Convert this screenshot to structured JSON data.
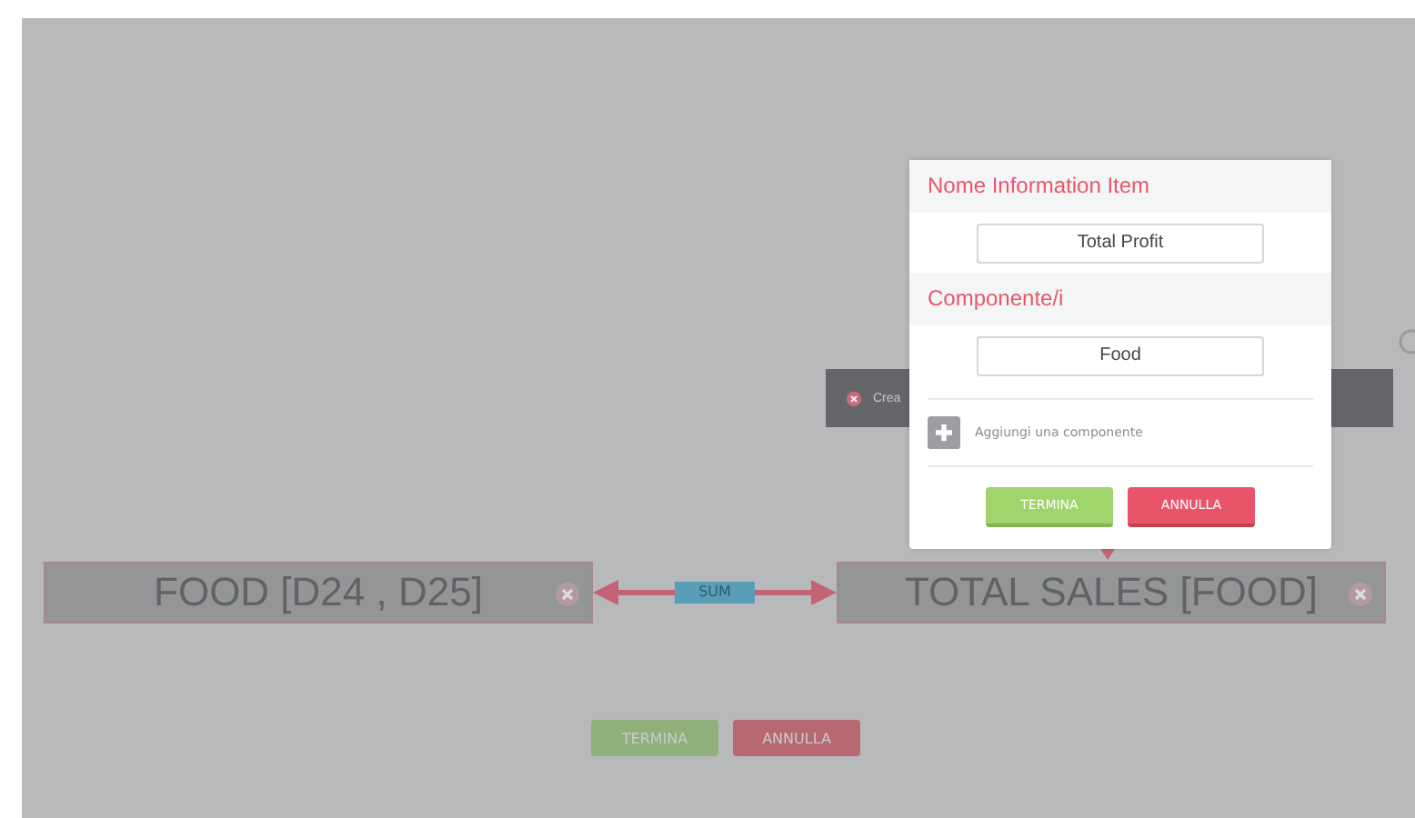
{
  "nodes": [
    {
      "label": "FOOD [D24 , D25]"
    },
    {
      "label": "TOTAL SALES [FOOD]"
    }
  ],
  "connector": {
    "label": "SUM"
  },
  "notice": {
    "text": "Crea"
  },
  "canvas_buttons": [
    {
      "label": "TERMINA",
      "kind": "confirm"
    },
    {
      "label": "ANNULLA",
      "kind": "cancel"
    }
  ],
  "dialog": {
    "sections": [
      {
        "title": "Nome Information Item",
        "value": "Total Profit"
      },
      {
        "title": "Componente/i",
        "value": "Food"
      }
    ],
    "add_component": {
      "label": "Aggiungi una componente"
    },
    "buttons": [
      {
        "label": "TERMINA",
        "kind": "confirm"
      },
      {
        "label": "ANNULLA",
        "kind": "cancel"
      }
    ]
  }
}
